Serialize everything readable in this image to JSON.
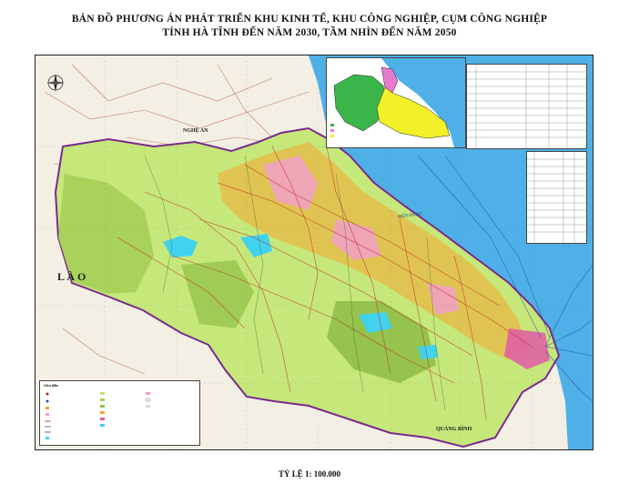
{
  "map": {
    "title_line1": "BẢN ĐỒ PHƯƠNG ÁN PHÁT TRIỂN KHU KINH TẾ, KHU CÔNG NGHIỆP, CỤM CÔNG NGHIỆP",
    "title_line2": "TỈNH HÀ TĨNH ĐẾN NĂM 2030, TẦM NHÌN ĐẾN NĂM 2050",
    "scale": "TỶ LỆ 1: 100.000",
    "labels": {
      "nghe_an": "NGHỆ AN",
      "lao": "L À O",
      "quang_binh": "QUẢNG BÌNH",
      "sea": "BIỂN ĐÔNG"
    },
    "legend_title": "Chú dẫn",
    "colors": {
      "sea": "#4fb0e8",
      "province": "#c6e87a",
      "forest": "#a5cf58",
      "pink": "#f0a0c8",
      "orange": "#f6a531",
      "lake": "#41d2ee",
      "boundary": "#7a2a8a"
    }
  }
}
